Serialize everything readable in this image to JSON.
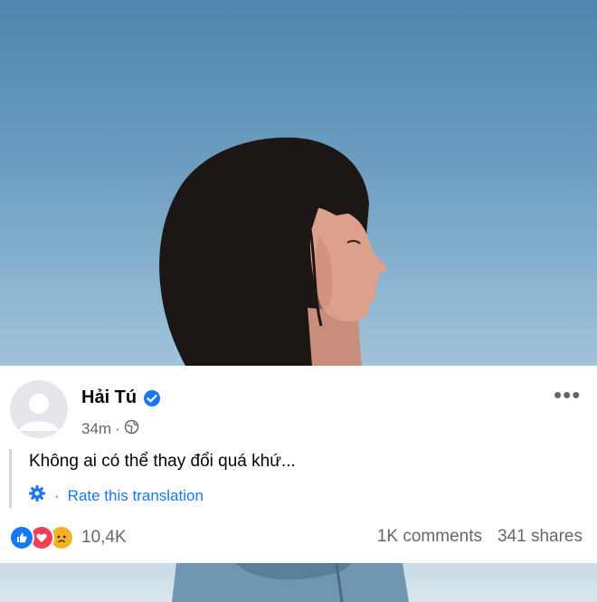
{
  "post": {
    "author_name": "Hải Tú",
    "verified": true,
    "time_ago": "34m",
    "separator": "·",
    "audience_icon": "globe-icon",
    "more_label": "•••",
    "text": "Không ai có thể thay đổi quá khứ...",
    "translation": {
      "separator": "·",
      "rate_label": "Rate this translation",
      "icon": "gear-icon"
    }
  },
  "engagement": {
    "reaction_icons": [
      "like-icon",
      "love-icon",
      "sad-icon"
    ],
    "reactions_count": "10,4K",
    "comments": "1K comments",
    "shares": "341 shares"
  },
  "colors": {
    "accent": "#1877f2",
    "secondary_text": "#65676b",
    "love": "#f33e58",
    "sad": "#f7b125"
  }
}
